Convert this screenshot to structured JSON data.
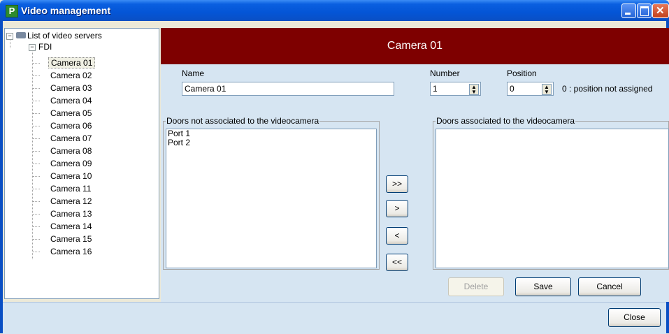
{
  "window": {
    "title": "Video management",
    "icon": "P"
  },
  "tree": {
    "root_label": "List of video servers",
    "server_label": "FDI",
    "cameras": [
      "Camera 01",
      "Camera 02",
      "Camera 03",
      "Camera 04",
      "Camera 05",
      "Camera 06",
      "Camera 07",
      "Camera 08",
      "Camera 09",
      "Camera 10",
      "Camera 11",
      "Camera 12",
      "Camera 13",
      "Camera 14",
      "Camera 15",
      "Camera 16"
    ],
    "selected_index": 0
  },
  "detail": {
    "header": "Camera 01",
    "name_label": "Name",
    "name_value": "Camera 01",
    "number_label": "Number",
    "number_value": "1",
    "position_label": "Position",
    "position_value": "0",
    "position_note": "0 : position not assigned",
    "not_associated_title": "Doors not associated to the videocamera",
    "not_associated_items": [
      "Port 1",
      "Port 2"
    ],
    "associated_title": "Doors associated to the videocamera",
    "associated_items": [],
    "btn_add_all": ">>",
    "btn_add": ">",
    "btn_remove": "<",
    "btn_remove_all": "<<",
    "btn_delete": "Delete",
    "btn_save": "Save",
    "btn_cancel": "Cancel"
  },
  "footer": {
    "close_label": "Close"
  }
}
